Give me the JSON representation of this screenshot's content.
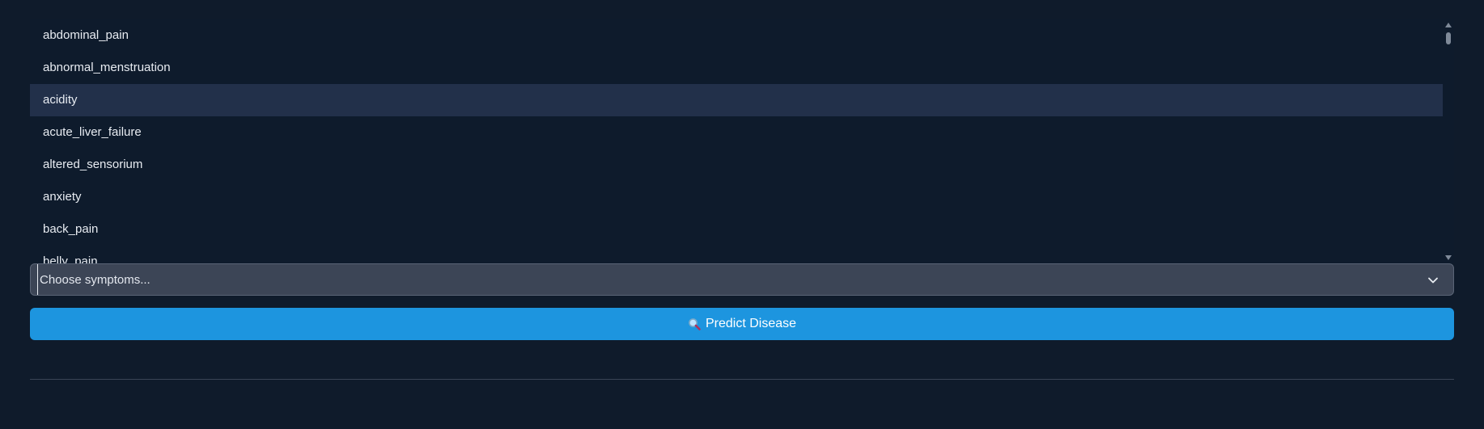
{
  "symptom_options": [
    "abdominal_pain",
    "abnormal_menstruation",
    "acidity",
    "acute_liver_failure",
    "altered_sensorium",
    "anxiety",
    "back_pain",
    "belly_pain"
  ],
  "highlighted_option": "acidity",
  "select": {
    "placeholder": "Choose symptoms..."
  },
  "predict_button": {
    "label": "Predict Disease",
    "icon": "magnifier-icon"
  },
  "colors": {
    "background": "#0f1b2b",
    "highlight": "#22304a",
    "select_background": "#3c4556",
    "button": "#1d95df"
  }
}
